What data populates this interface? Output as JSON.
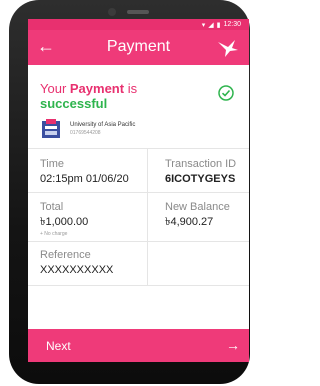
{
  "status_bar": {
    "time": "12:30"
  },
  "app_bar": {
    "title": "Payment",
    "back_icon": "back-arrow-icon",
    "logo_icon": "bird-logo-icon"
  },
  "success": {
    "line1_prefix": "Your ",
    "line1_bold": "Payment",
    "line1_suffix": " is",
    "line2": "successful"
  },
  "recipient": {
    "name": "University of Asia Pacific",
    "phone": "01769544208"
  },
  "details": {
    "time_label": "Time",
    "time_value": "02:15pm 01/06/20",
    "txn_label": "Transaction ID",
    "txn_value": "6ICOTYGEYS",
    "total_label": "Total",
    "total_value": "৳1,000.00",
    "total_note": "+ No charge",
    "balance_label": "New Balance",
    "balance_value": "৳4,900.27",
    "reference_label": "Reference",
    "reference_value": "XXXXXXXXXX"
  },
  "footer": {
    "next_label": "Next",
    "arrow_icon": "arrow-right-icon"
  },
  "colors": {
    "accent": "#ef3a79",
    "success": "#2eb44d"
  }
}
